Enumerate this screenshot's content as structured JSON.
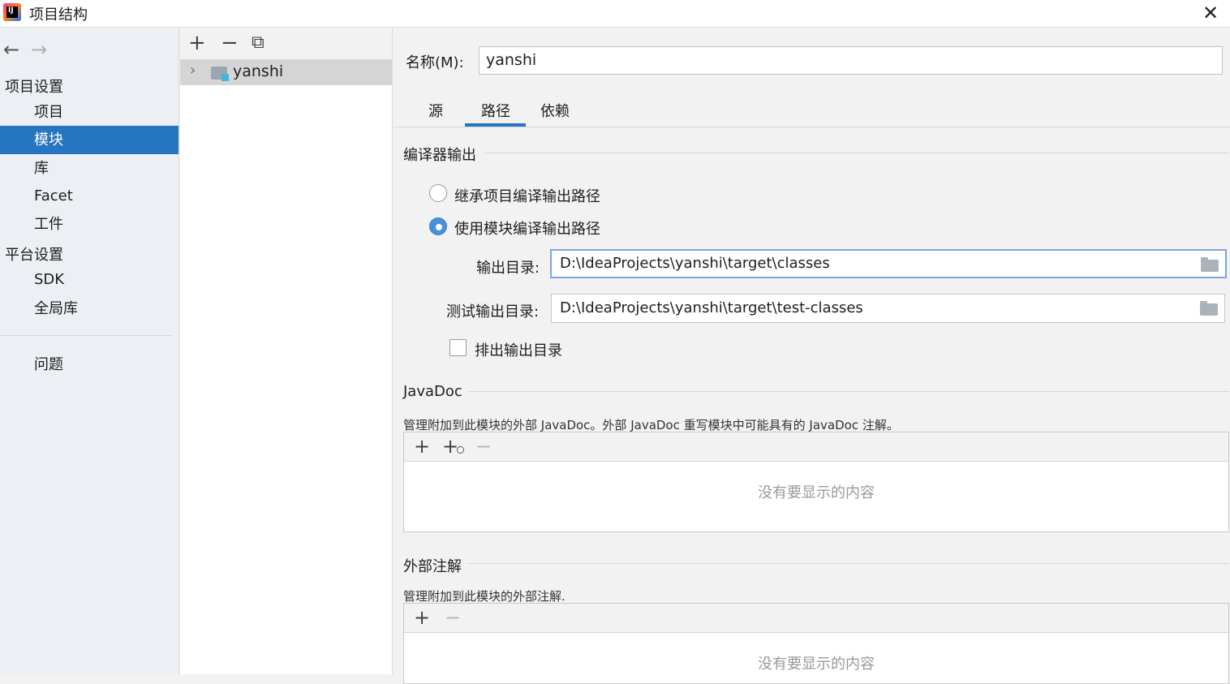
{
  "window": {
    "title": "项目结构",
    "close_glyph": "✕"
  },
  "nav": {
    "back_glyph": "←",
    "forward_glyph": "→",
    "project_settings_header": "项目设置",
    "project_items": [
      "项目",
      "模块",
      "库",
      "Facet",
      "工件"
    ],
    "selected": "模块",
    "platform_settings_header": "平台设置",
    "platform_items": [
      "SDK",
      "全局库"
    ],
    "problems": "问题"
  },
  "module_tree": {
    "toolbar": {
      "add": "+",
      "remove": "−",
      "copy": "⧉"
    },
    "items": [
      {
        "label": "yanshi",
        "expanded": false
      }
    ]
  },
  "details": {
    "name_label": "名称(M):",
    "name_value": "yanshi",
    "tabs": [
      "源",
      "路径",
      "依赖"
    ],
    "active_tab": "路径",
    "compiler_output": {
      "title": "编译器输出",
      "option_inherit": "继承项目编译输出路径",
      "option_module": "使用模块编译输出路径",
      "selected_option": "使用模块编译输出路径",
      "output_dir_label": "输出目录:",
      "output_dir_value": "D:\\IdeaProjects\\yanshi\\target\\classes",
      "test_output_dir_label": "测试输出目录:",
      "test_output_dir_value": "D:\\IdeaProjects\\yanshi\\target\\test-classes",
      "exclude_label": "排出输出目录",
      "exclude_checked": false
    },
    "javadoc": {
      "title": "JavaDoc",
      "description": "管理附加到此模块的外部 JavaDoc。外部 JavaDoc 重写模块中可能具有的 JavaDoc 注解。",
      "empty_text": "没有要显示的内容"
    },
    "annotations": {
      "title": "外部注解",
      "description": "管理附加到此模块的外部注解.",
      "empty_text": "没有要显示的内容"
    }
  },
  "colors": {
    "selection": "#2675bf",
    "accent": "#4a90d9"
  }
}
